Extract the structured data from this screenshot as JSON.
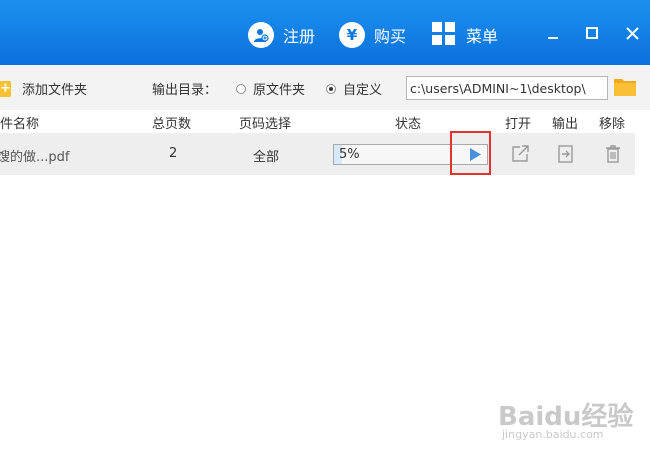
{
  "titlebar": {
    "register_label": "注册",
    "buy_label": "购买",
    "buy_icon_glyph": "¥",
    "menu_label": "菜单",
    "accent_color": "#0b76de"
  },
  "toolbar": {
    "add_folder_label": "添加文件夹",
    "output_dir_label": "输出目录：",
    "radio_original_label": "原文件夹",
    "radio_custom_label": "自定义",
    "selected_output": "自定义",
    "path_value": "c:\\users\\ADMINI~1\\desktop\\"
  },
  "table": {
    "headers": {
      "filename": "文件名称",
      "pages": "总页数",
      "page_select": "页码选择",
      "status": "状态",
      "open": "打开",
      "output": "输出",
      "remove": "移除"
    },
    "rows": [
      {
        "filename": "馊的做...pdf",
        "pages": "2",
        "page_select": "全部",
        "progress_text": "5%",
        "progress_value": 0.05
      }
    ]
  },
  "watermark": {
    "text": "Baidu经验",
    "sub": "jingyan.baidu.com"
  }
}
